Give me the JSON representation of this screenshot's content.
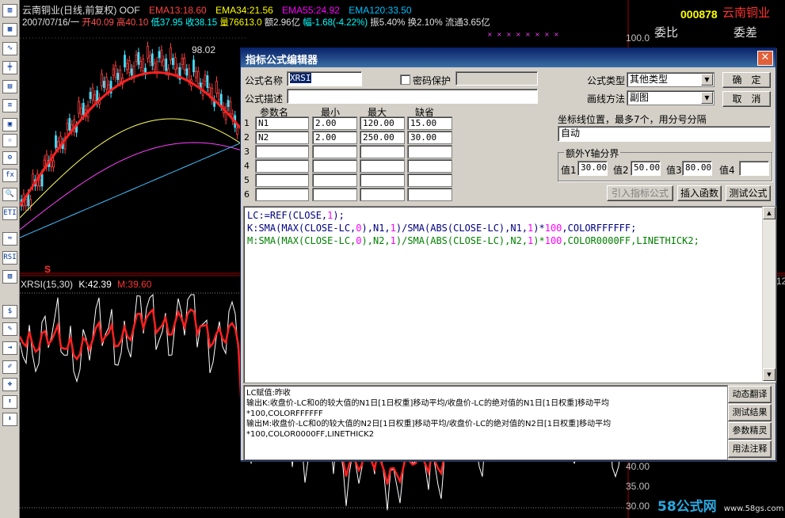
{
  "chart_header": {
    "title_line": "云南铜业(日线,前复权) OOF",
    "ema13": "EMA13:18.60",
    "ema34": "EMA34:21.56",
    "ema55": "EMA55:24.92",
    "ema120": "EMA120:33.50",
    "date": "2007/07/16/一",
    "open": "开40.09",
    "high": "高40.10",
    "low": "低37.95",
    "close": "收38.15",
    "volume": "量76613.0",
    "amount": "额2.96亿",
    "change": "幅-1.68(-4.22%)",
    "amplitude": "振5.40%",
    "turnover": "换2.10%",
    "float": "流通3.65亿",
    "peak_label": "98.02",
    "xrsi_name": "XRSI(15,30)",
    "xrsi_k": "K:42.39",
    "xrsi_m": "M:39.60",
    "s_marker": "S"
  },
  "right_panel": {
    "code": "000878",
    "name": "云南铜业",
    "weibi": "委比",
    "weicha": "委差",
    "price_tick": "100.0",
    "ticks": [
      "40.00",
      "35.00",
      "30.00"
    ],
    "partial_12": "12"
  },
  "watermark": {
    "site": "58公式网",
    "url": "www.58gs.com"
  },
  "left_toolbar": {
    "icons": [
      "chart-icon",
      "grid-icon",
      "line-icon",
      "candle-icon",
      "table-icon",
      "list-icon",
      "doc-icon",
      "star-icon",
      "gear-icon",
      "fx-icon",
      "find-icon",
      "eti-icon",
      "wave-icon",
      "rsi-icon",
      "calc-icon",
      "dollar-icon",
      "tool-icon",
      "in-icon",
      "pen-icon",
      "move-icon",
      "up-icon",
      "down-icon"
    ],
    "texts": [
      "▥",
      "▦",
      "∿",
      "╪",
      "▤",
      "≡",
      "▣",
      "☆",
      "⚙",
      "fx",
      "🔍",
      "ETI",
      "≈",
      "RSI",
      "▧",
      "$",
      "✎",
      "⇥",
      "✐",
      "✥",
      "⬆",
      "⬇"
    ]
  },
  "dialog": {
    "title": "指标公式编辑器",
    "close": "✕",
    "name_label": "公式名称",
    "name_value": "XRSI",
    "password_label": "密码保护",
    "desc_label": "公式描述",
    "desc_value": "",
    "type_label": "公式类型",
    "type_value": "其他类型",
    "draw_label": "画线方法",
    "draw_value": "副图",
    "ok": "确　定",
    "cancel": "取　消",
    "params_headers": [
      "参数名",
      "最小",
      "最大",
      "缺省"
    ],
    "params": [
      {
        "row": "1",
        "name": "N1",
        "min": "2.00",
        "max": "120.00",
        "default": "15.00"
      },
      {
        "row": "2",
        "name": "N2",
        "min": "2.00",
        "max": "250.00",
        "default": "30.00"
      },
      {
        "row": "3",
        "name": "",
        "min": "",
        "max": "",
        "default": ""
      },
      {
        "row": "4",
        "name": "",
        "min": "",
        "max": "",
        "default": ""
      },
      {
        "row": "5",
        "name": "",
        "min": "",
        "max": "",
        "default": ""
      },
      {
        "row": "6",
        "name": "",
        "min": "",
        "max": "",
        "default": ""
      }
    ],
    "coord_label": "坐标线位置，最多7个，用分号分隔",
    "coord_value": "自动",
    "yaxis_group": "额外Y轴分界",
    "y_labels": [
      "值1",
      "值2",
      "值3",
      "值4"
    ],
    "y_values": [
      "30.00",
      "50.00",
      "80.00",
      ""
    ],
    "import_btn": "引入指标公式",
    "insert_btn": "插入函数",
    "test_btn": "测试公式",
    "code": [
      [
        [
          "LC:=REF(",
          "#000080"
        ],
        [
          "CLOSE",
          "#000080"
        ],
        [
          ",",
          "#000080"
        ],
        [
          "1",
          "#ff00ff"
        ],
        [
          ");",
          "#000080"
        ]
      ],
      [
        [
          "K:SMA(MAX(CLOSE-LC,",
          "#000080"
        ],
        [
          "0",
          "#ff00ff"
        ],
        [
          "),N1,",
          "#000080"
        ],
        [
          "1",
          "#ff00ff"
        ],
        [
          ")/SMA(ABS(CLOSE-LC),N1,",
          "#000080"
        ],
        [
          "1",
          "#ff00ff"
        ],
        [
          ")*",
          "#000080"
        ],
        [
          "100",
          "#ff00ff"
        ],
        [
          ",COLORFFFFFF;",
          "#000080"
        ]
      ],
      [
        [
          "M:SMA(MAX(CLOSE-LC,",
          "#008000"
        ],
        [
          "0",
          "#ff00ff"
        ],
        [
          "),N2,",
          "#008000"
        ],
        [
          "1",
          "#ff00ff"
        ],
        [
          ")/SMA(ABS(CLOSE-LC),N2,",
          "#008000"
        ],
        [
          "1",
          "#ff00ff"
        ],
        [
          ")*",
          "#008000"
        ],
        [
          "100",
          "#ff00ff"
        ],
        [
          ",COLOR0000FF,LINETHICK2;",
          "#008000"
        ]
      ]
    ],
    "explain": [
      "LC赋值:昨收",
      "输出K:收盘价-LC和0的较大值的N1日[1日权重]移动平均/收盘价-LC的绝对值的N1日[1日权重]移动平均",
      "*100,COLORFFFFFF",
      "输出M:收盘价-LC和0的较大值的N2日[1日权重]移动平均/收盘价-LC的绝对值的N2日[1日权重]移动平均",
      "*100,COLOR0000FF,LINETHICK2"
    ],
    "side_buttons": [
      "动态翻译",
      "测试结果",
      "参数精灵",
      "用法注释"
    ]
  },
  "colors": {
    "accent_red": "#ff0000",
    "ema13": "#ff4040",
    "ema34": "#ffff00",
    "ema55": "#ff00ff",
    "ema120": "#00c0ff",
    "title_bar": "#0a246a"
  }
}
